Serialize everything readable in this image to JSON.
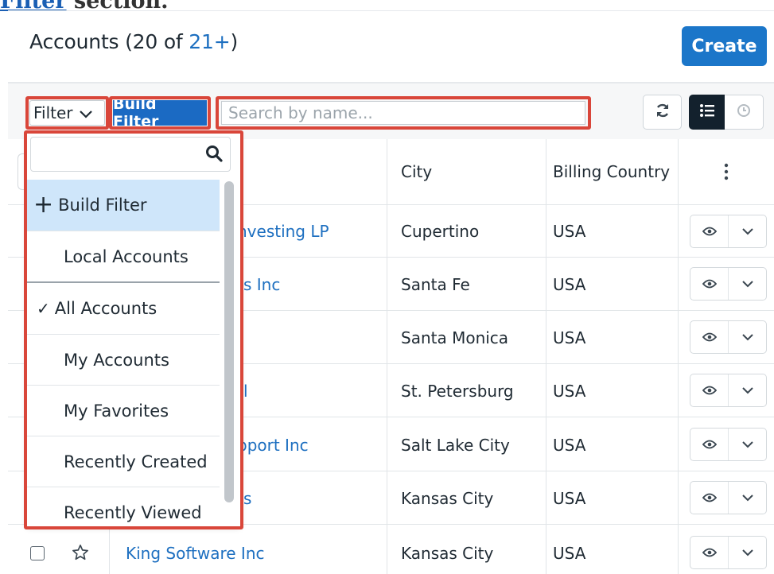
{
  "doc_fragment": {
    "link": "Filter",
    "suffix": " section."
  },
  "header": {
    "title_prefix": "Accounts (20 of ",
    "count_link": "21+",
    "title_suffix": ")",
    "create_label": "Create"
  },
  "toolbar": {
    "filter_label": "Filter",
    "active_filter_tag": "Build Filter",
    "search_placeholder": "Search by name..."
  },
  "table": {
    "columns": [
      "City",
      "Billing Country"
    ],
    "rows": [
      {
        "name": "nvesting LP",
        "city": "Cupertino",
        "country": "USA"
      },
      {
        "name": "s Inc",
        "city": "Santa Fe",
        "country": "USA"
      },
      {
        "name": "",
        "city": "Santa Monica",
        "country": "USA"
      },
      {
        "name": "l",
        "city": "St. Petersburg",
        "country": "USA"
      },
      {
        "name": "pport Inc",
        "city": "Salt Lake City",
        "country": "USA"
      },
      {
        "name": "s",
        "city": "Kansas City",
        "country": "USA"
      },
      {
        "name": "King Software Inc",
        "city": "Kansas City",
        "country": "USA"
      }
    ]
  },
  "filter_menu": {
    "items": [
      {
        "label": "Build Filter",
        "prefix": "+",
        "highlighted": true
      },
      {
        "label": "Local Accounts"
      },
      {
        "label": "All Accounts",
        "prefix": "✓",
        "selected": true
      },
      {
        "label": "My Accounts"
      },
      {
        "label": "My Favorites"
      },
      {
        "label": "Recently Created"
      },
      {
        "label": "Recently Viewed"
      }
    ]
  },
  "colors": {
    "accent": "#1b76c9",
    "highlight": "#d9463a",
    "menu_highlight": "#cfe6fa"
  }
}
